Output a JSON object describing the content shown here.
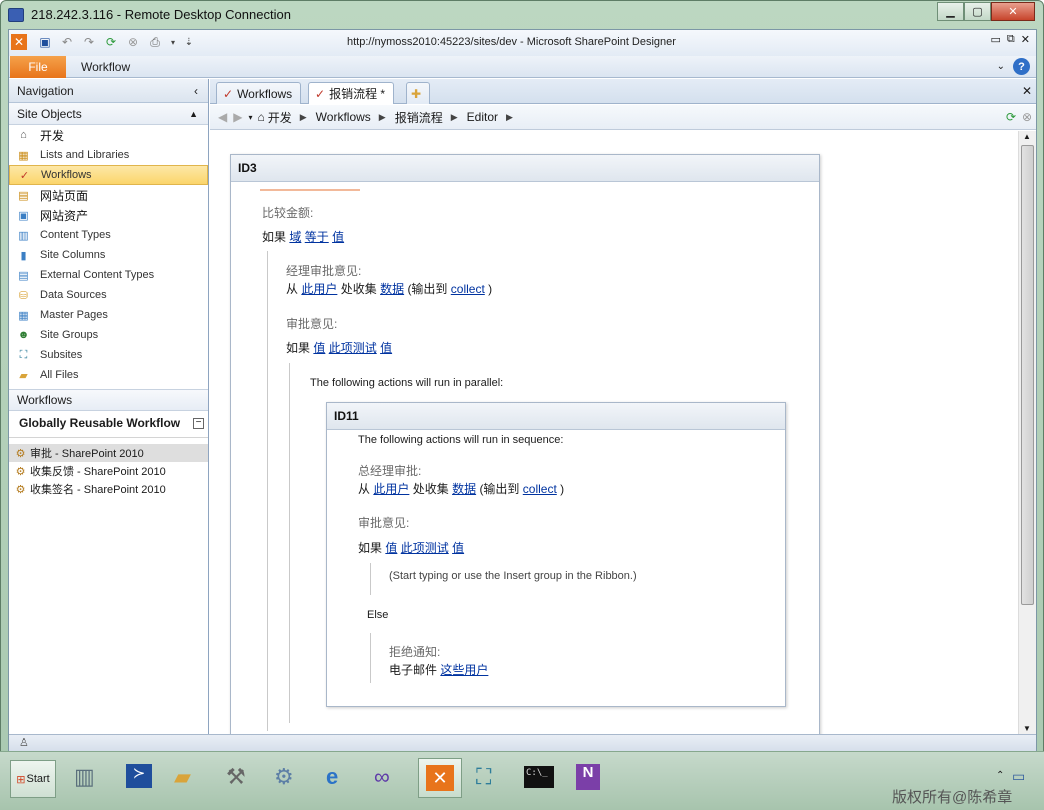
{
  "window": {
    "title": "218.242.3.116 - Remote Desktop Connection"
  },
  "app": {
    "title": "http://nymoss2010:45223/sites/dev  -  Microsoft SharePoint Designer"
  },
  "ribbon": {
    "file_tab": "File",
    "workflow_tab": "Workflow"
  },
  "nav": {
    "header": "Navigation",
    "site_objects_header": "Site Objects",
    "items": [
      {
        "label": "开发",
        "icon": "home-icon"
      },
      {
        "label": "Lists and Libraries",
        "icon": "list-icon"
      },
      {
        "label": "Workflows",
        "icon": "workflow-icon"
      },
      {
        "label": "网站页面",
        "icon": "pages-icon"
      },
      {
        "label": "网站资产",
        "icon": "assets-icon"
      },
      {
        "label": "Content Types",
        "icon": "content-types-icon"
      },
      {
        "label": "Site Columns",
        "icon": "columns-icon"
      },
      {
        "label": "External Content Types",
        "icon": "external-icon"
      },
      {
        "label": "Data Sources",
        "icon": "database-icon"
      },
      {
        "label": "Master Pages",
        "icon": "master-page-icon"
      },
      {
        "label": "Site Groups",
        "icon": "group-icon"
      },
      {
        "label": "Subsites",
        "icon": "subsites-icon"
      },
      {
        "label": "All Files",
        "icon": "folder-icon"
      }
    ],
    "workflows_header": "Workflows",
    "globally_reusable": "Globally Reusable Workflow",
    "workflow_items": [
      {
        "label": "审批 - SharePoint 2010"
      },
      {
        "label": "收集反馈 - SharePoint 2010"
      },
      {
        "label": "收集签名 - SharePoint 2010"
      }
    ]
  },
  "tabs": [
    {
      "label": "Workflows"
    },
    {
      "label": "报销流程 *"
    }
  ],
  "breadcrumb": [
    "开发",
    "Workflows",
    "报销流程",
    "Editor"
  ],
  "editor": {
    "step1": {
      "title": "ID3",
      "cond_label": "比较金额:",
      "cond": {
        "if": "如果",
        "field": "域",
        "op": "等于",
        "value": "值"
      },
      "action1_label": "经理审批意见:",
      "action1": {
        "from": "从",
        "user": "此用户",
        "collect": "处收集",
        "data": "数据",
        "output": "(输出到",
        "var": "collect",
        "close": ")"
      },
      "cond2_label": "审批意见:",
      "cond2": {
        "if": "如果",
        "value1": "值",
        "op": "此项测试",
        "value2": "值"
      },
      "parallel": "The following actions will run in parallel:"
    },
    "step2": {
      "title": "ID11",
      "sequence": "The following actions will run in sequence:",
      "action_label": "总经理审批:",
      "action": {
        "from": "从",
        "user": "此用户",
        "collect": "处收集",
        "data": "数据",
        "output": "(输出到",
        "var": "collect",
        "close": ")"
      },
      "cond_label": "审批意见:",
      "cond": {
        "if": "如果",
        "value1": "值",
        "op": "此项测试",
        "value2": "值"
      },
      "placeholder": "(Start typing or use the Insert group in the Ribbon.)",
      "else": "Else",
      "reject_label": "拒绝通知:",
      "reject": {
        "email": "电子邮件",
        "users": "这些用户"
      }
    }
  },
  "taskbar": {
    "start": "Start",
    "watermark": "版权所有@陈希章"
  }
}
